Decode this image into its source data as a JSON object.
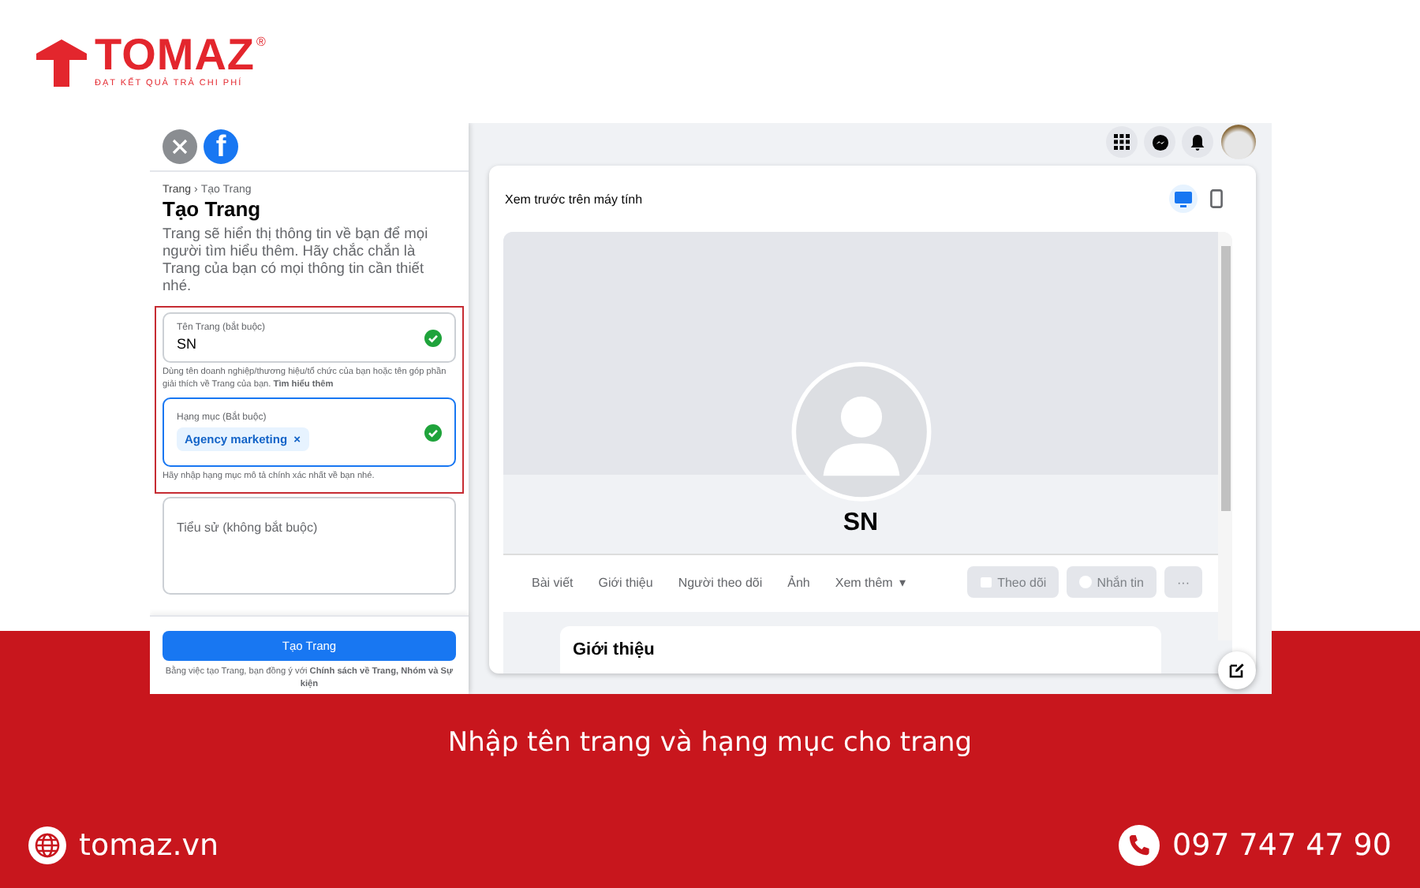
{
  "brand": {
    "name": "TOMAZ",
    "registered": "®",
    "tagline": "ĐẠT KẾT QUẢ TRẢ CHI PHÍ"
  },
  "screen": {
    "sidebar": {
      "logo_letter": "f",
      "breadcrumb": [
        "Trang",
        "Tạo Trang"
      ],
      "breadcrumb_separator": "›",
      "title": "Tạo Trang",
      "description": "Trang sẽ hiển thị thông tin về bạn để mọi người tìm hiểu thêm. Hãy chắc chắn là Trang của bạn có mọi thông tin cần thiết nhé.",
      "highlighted_fields": [
        {
          "kind": "text",
          "label": "Tên Trang (bắt buộc)",
          "value": "SN",
          "valid": true,
          "focused": false,
          "help": "Dùng tên doanh nghiệp/thương hiệu/tổ chức của bạn hoặc tên góp phần giải thích về Trang của bạn. **Tìm hiểu thêm**"
        },
        {
          "kind": "tags",
          "label": "Hạng mục (Bắt buộc)",
          "tags": [
            {
              "label": "Agency marketing",
              "remove": "×"
            }
          ],
          "valid": true,
          "focused": true,
          "help": "Hãy nhập hạng mục mô tả chính xác nhất về bạn nhé."
        }
      ],
      "bio": {
        "placeholder": "Tiểu sử (không bắt buộc)"
      },
      "submit": "Tạo Trang",
      "terms": "Bằng việc tạo Trang, bạn đồng ý với **Chính sách về Trang, Nhóm và Sự kiện**"
    },
    "preview": {
      "title": "Xem trước trên máy tính",
      "devices": [
        {
          "kind": "desktop",
          "selected": true
        },
        {
          "kind": "mobile",
          "selected": false
        }
      ],
      "page_name": "SN",
      "tabs": [
        {
          "label": "Bài viết"
        },
        {
          "label": "Giới thiệu"
        },
        {
          "label": "Người theo dõi"
        },
        {
          "label": "Ảnh"
        },
        {
          "label": "Xem thêm",
          "caret": "▾"
        }
      ],
      "actions": [
        {
          "kind": "follow",
          "label": "Theo dõi",
          "disabled": true
        },
        {
          "kind": "message",
          "label": "Nhắn tin",
          "disabled": true
        },
        {
          "kind": "more",
          "label": "···",
          "disabled": true
        }
      ],
      "section_title": "Giới thiệu"
    }
  },
  "caption": "Nhập tên trang và hạng mục cho trang",
  "footer": {
    "website": "tomaz.vn",
    "phone": "097 747 47 90"
  }
}
